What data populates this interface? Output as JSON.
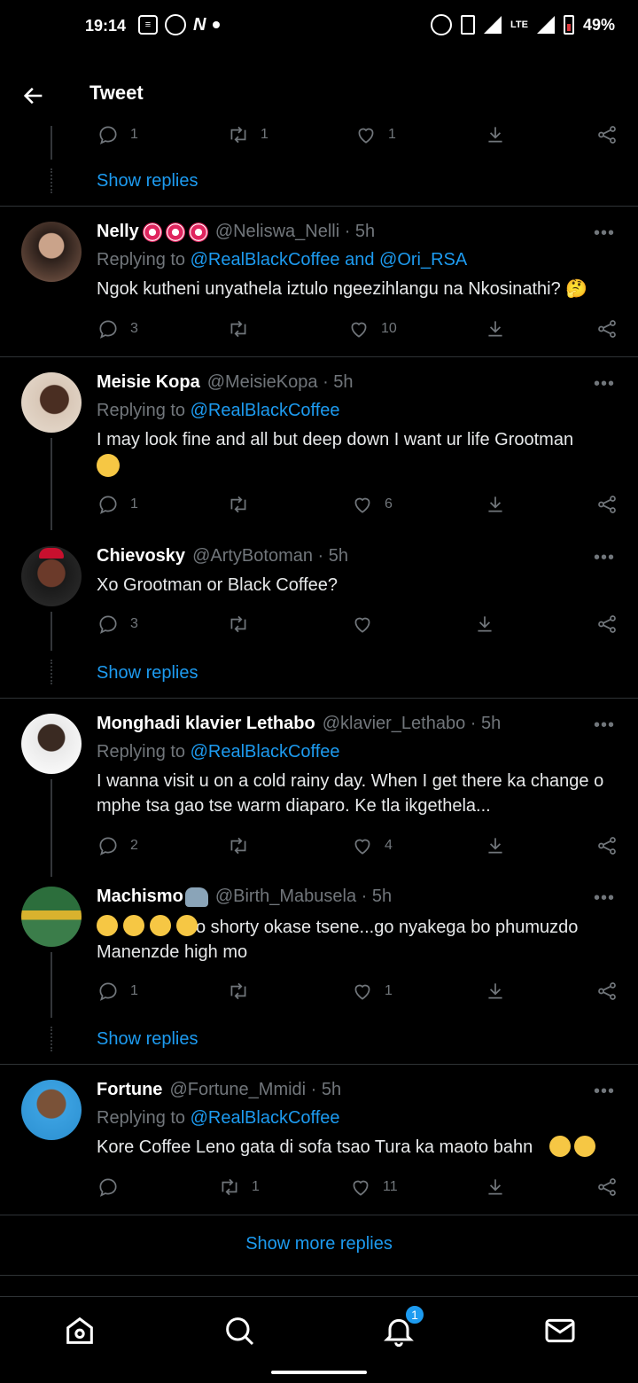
{
  "status_bar": {
    "time": "19:14",
    "network": "LTE",
    "battery": "49%"
  },
  "header": {
    "title": "Tweet"
  },
  "top_partial": {
    "reply_count": "1",
    "retweet_count": "1",
    "like_count": "1",
    "show_replies": "Show replies"
  },
  "tweets": [
    {
      "name": "Nelly",
      "handle": "@Neliswa_Nelli · 5h",
      "replying_prefix": "Replying to ",
      "replying_to": "@RealBlackCoffee and @Ori_RSA",
      "text": "Ngok kutheni unyathela iztulo ngeezihlangu na Nkosinathi? 🤔",
      "reply_count": "3",
      "retweet_count": "",
      "like_count": "10"
    },
    {
      "name": "Meisie Kopa",
      "handle": "@MeisieKopa · 5h",
      "replying_prefix": "Replying to ",
      "replying_to": "@RealBlackCoffee",
      "text": "I may look fine and all but deep down I want ur life Grootman",
      "reply_count": "1",
      "retweet_count": "",
      "like_count": "6"
    },
    {
      "name": "Chievosky",
      "handle": "@ArtyBotoman · 5h",
      "text": "Xo Grootman or Black Coffee?",
      "reply_count": "3",
      "retweet_count": "",
      "like_count": ""
    },
    {
      "name": "Monghadi klavier Lethabo",
      "handle": "@klavier_Lethabo · 5h",
      "replying_prefix": "Replying to ",
      "replying_to": "@RealBlackCoffee",
      "text": "I wanna visit u on a cold rainy day. When I get there ka change o mphe tsa gao tse warm diaparo. Ke tla ikgethela...",
      "reply_count": "2",
      "retweet_count": "",
      "like_count": "4"
    },
    {
      "name": "Machismo",
      "handle": "@Birth_Mabusela · 5h",
      "text": "o shorty okase tsene...go nyakega bo phumuzdo Manenzde high mo",
      "reply_count": "1",
      "retweet_count": "",
      "like_count": "1"
    },
    {
      "name": "Fortune",
      "handle": "@Fortune_Mmidi · 5h",
      "replying_prefix": "Replying to ",
      "replying_to": "@RealBlackCoffee",
      "text": "Kore Coffee Leno gata di sofa tsao Tura ka maoto bahn",
      "reply_count": "",
      "retweet_count": "1",
      "like_count": "11"
    }
  ],
  "show_replies_label": "Show replies",
  "show_more_replies": "Show more replies",
  "nav": {
    "notifications_badge": "1"
  },
  "colors": {
    "background": "#000000",
    "accent": "#1d9bf0",
    "muted": "#71767b",
    "divider": "#2f3336"
  }
}
